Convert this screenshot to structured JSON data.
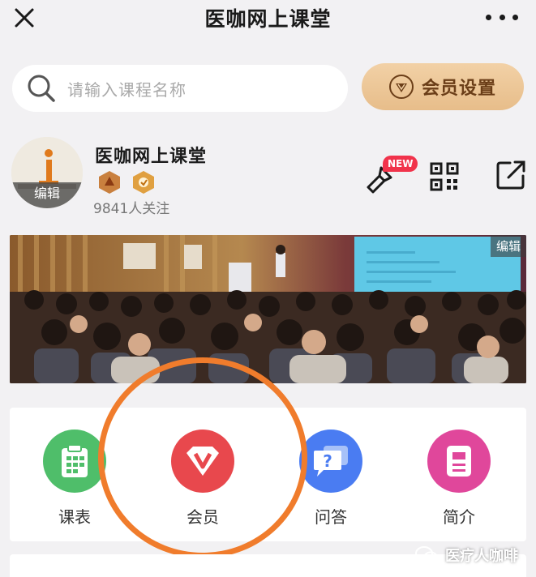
{
  "header": {
    "title": "医咖网上课堂",
    "close_icon": "close-icon",
    "more_icon": "more-icon"
  },
  "search": {
    "placeholder": "请输入课程名称"
  },
  "vip_button": {
    "label": "会员设置"
  },
  "profile": {
    "name": "医咖网上课堂",
    "avatar_edit": "编辑",
    "followers": "9841人关注",
    "new_badge": "NEW"
  },
  "banner": {
    "edit_label": "编辑"
  },
  "menu": {
    "items": [
      {
        "label": "课表",
        "icon": "schedule-icon",
        "color": "#4fbe6a"
      },
      {
        "label": "会员",
        "icon": "vip-diamond-icon",
        "color": "#e8484d"
      },
      {
        "label": "问答",
        "icon": "qa-icon",
        "color": "#4a7cf2"
      },
      {
        "label": "简介",
        "icon": "intro-icon",
        "color": "#e0479b"
      }
    ]
  },
  "watermark": {
    "text": "医疗人咖啡"
  },
  "colors": {
    "accent_gold": "#e7bd8a",
    "highlight_ring": "#f07c2c",
    "new_badge": "#f1334b"
  }
}
